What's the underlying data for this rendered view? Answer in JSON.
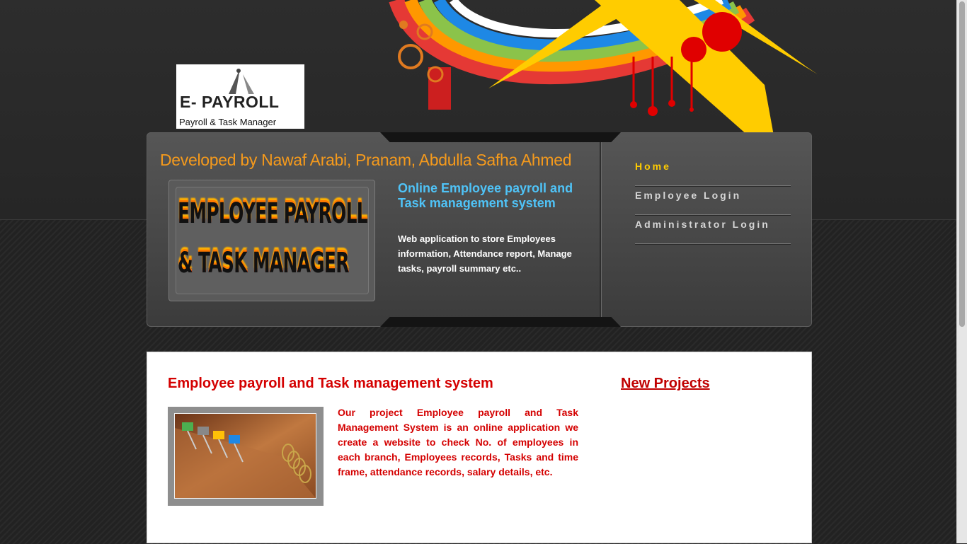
{
  "logo": {
    "title": "E- PAYROLL",
    "subtitle": "Payroll & Task Manager"
  },
  "header": {
    "developer_credit": "Developed by Nawaf Arabi, Pranam, Abdulla Safha Ahmed",
    "banner_line1": "EMPLOYEE PAYROLL",
    "banner_line2": "& TASK MANAGER",
    "intro_title": "Online Employee payroll and Task management system",
    "intro_text": "Web application to store Employees information, Attendance report, Manage tasks, payroll summary etc.."
  },
  "nav": {
    "items": [
      {
        "label": "Home",
        "active": true
      },
      {
        "label": "Employee Login",
        "active": false
      },
      {
        "label": "Administrator Login",
        "active": false
      }
    ]
  },
  "main": {
    "title": "Employee payroll and Task management system",
    "description": "Our project Employee payroll and Task Management System is an online application we create a website to check No. of employees in each branch, Employees records, Tasks and time frame, attendance records, salary details, etc.",
    "projects_heading": "New Projects"
  },
  "colors": {
    "accent_orange": "#f59a1c",
    "intro_blue": "#4fc3f7",
    "active_nav": "#ffcc00",
    "content_red": "#d40000"
  }
}
